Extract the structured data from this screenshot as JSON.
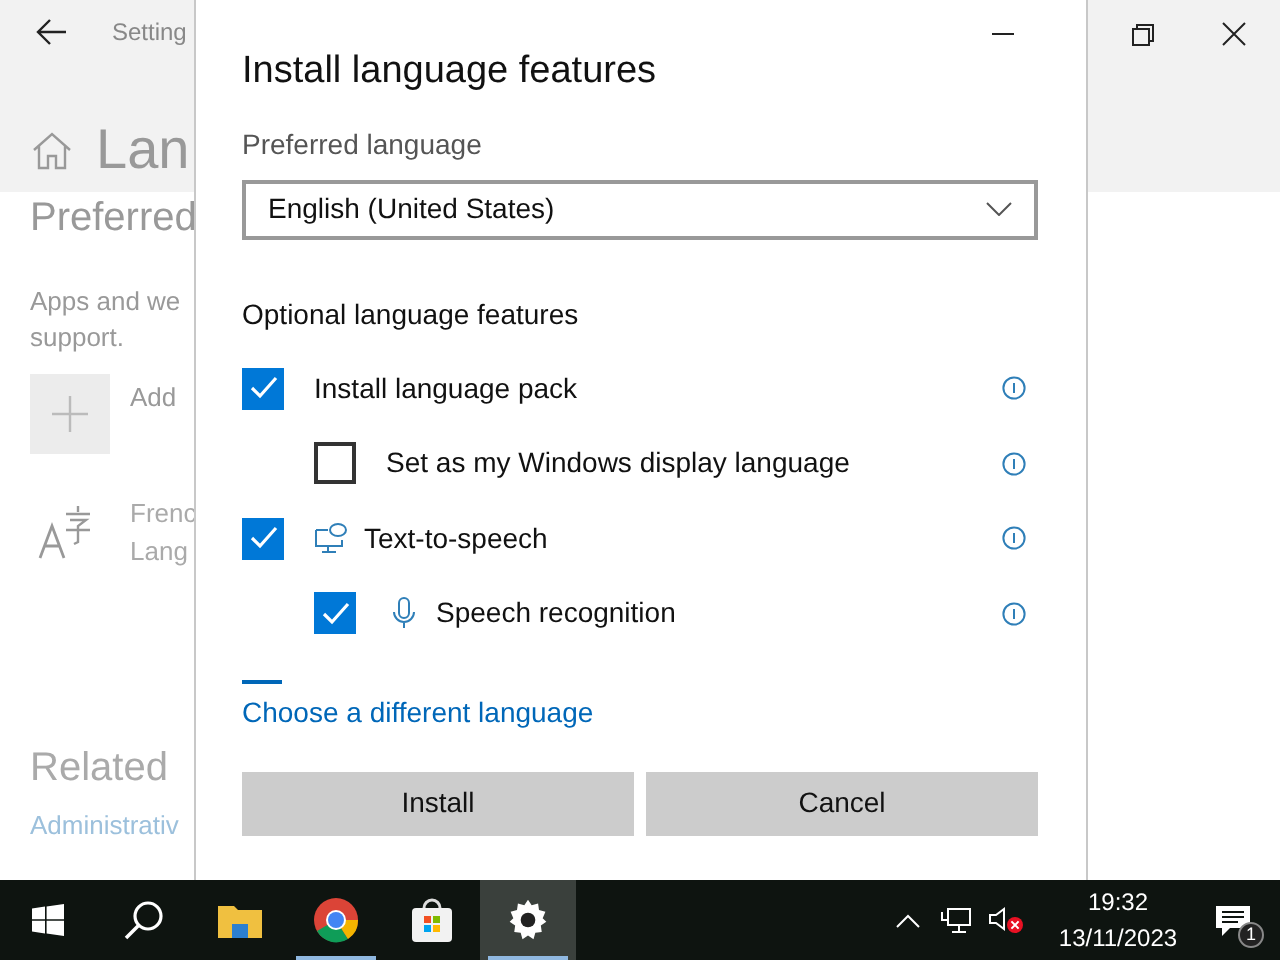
{
  "background_window": {
    "breadcrumb": "Setting",
    "title": "Lan",
    "section_heading": "Preferred",
    "description_lines": [
      "Apps and we",
      "support."
    ],
    "add_item": "Add",
    "language_item": {
      "name": "Frenc",
      "subtitle": "Lang"
    },
    "related_heading": "Related",
    "related_link": "Administrativ"
  },
  "dialog": {
    "title": "Install language features",
    "preferred_label": "Preferred language",
    "dropdown_value": "English (United States)",
    "features_heading": "Optional language features",
    "features": [
      {
        "kind": "plain",
        "label": "Install language pack",
        "checked": true,
        "children": [
          {
            "kind": "plain",
            "label": "Set as my Windows display language",
            "checked": false
          }
        ]
      },
      {
        "kind": "speech",
        "label": "Text-to-speech",
        "checked": true,
        "children": [
          {
            "kind": "mic",
            "label": "Speech recognition",
            "checked": true
          }
        ]
      }
    ],
    "link": "Choose a different language",
    "buttons": [
      "Install",
      "Cancel"
    ]
  },
  "taskbar": {
    "apps": [
      {
        "kind": "explorer",
        "running": false,
        "active": false
      },
      {
        "kind": "chrome",
        "running": true,
        "active": false
      },
      {
        "kind": "store",
        "running": false,
        "active": false
      },
      {
        "kind": "settings",
        "running": true,
        "active": true
      }
    ],
    "time": "19:32",
    "date": "13/11/2023",
    "notification_count": "1"
  }
}
